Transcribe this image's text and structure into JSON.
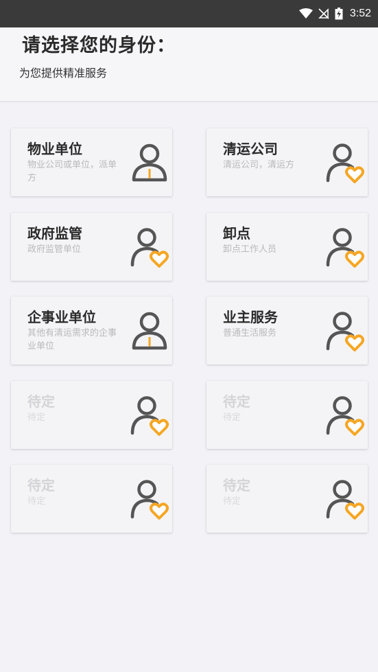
{
  "status_bar": {
    "time": "3:52",
    "icons": [
      "wifi-icon",
      "no-signal-icon",
      "battery-charging-icon"
    ]
  },
  "header": {
    "title": "请选择您的身份：",
    "subtitle": "为您提供精准服务"
  },
  "colors": {
    "accent": "#f5a623",
    "icon_gray": "#555555",
    "status_bar": "#3a3a3a",
    "background": "#f3f2f7"
  },
  "cards": [
    {
      "title": "物业单位",
      "desc": "物业公司或单位，派单方",
      "icon": "person-tie-icon",
      "enabled": true
    },
    {
      "title": "清运公司",
      "desc": "清运公司，清运方",
      "icon": "person-heart-icon",
      "enabled": true
    },
    {
      "title": "政府监管",
      "desc": "政府监管单位",
      "icon": "person-heart-icon",
      "enabled": true
    },
    {
      "title": "卸点",
      "desc": "卸点工作人员",
      "icon": "person-heart-icon",
      "enabled": true
    },
    {
      "title": "企事业单位",
      "desc": "其他有清运需求的企事业单位",
      "icon": "person-tie-icon",
      "enabled": true
    },
    {
      "title": "业主服务",
      "desc": "普通生活服务",
      "icon": "person-heart-icon",
      "enabled": true
    },
    {
      "title": "待定",
      "desc": "待定",
      "icon": "person-heart-icon",
      "enabled": false
    },
    {
      "title": "待定",
      "desc": "待定",
      "icon": "person-heart-icon",
      "enabled": false
    },
    {
      "title": "待定",
      "desc": "待定",
      "icon": "person-heart-icon",
      "enabled": false
    },
    {
      "title": "待定",
      "desc": "待定",
      "icon": "person-heart-icon",
      "enabled": false
    }
  ]
}
